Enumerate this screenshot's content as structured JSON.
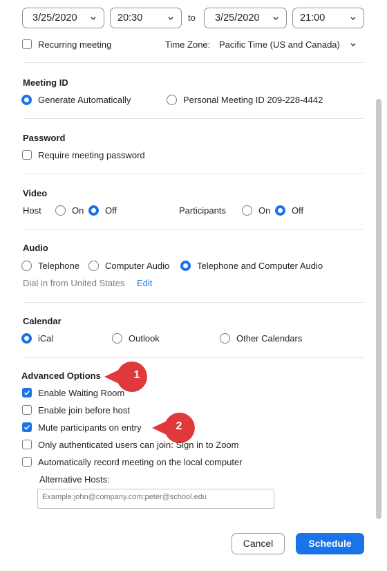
{
  "datetime": {
    "start_date": "3/25/2020",
    "start_time": "20:30",
    "to_label": "to",
    "end_date": "3/25/2020",
    "end_time": "21:00"
  },
  "recurring": {
    "label": "Recurring meeting",
    "checked": false
  },
  "timezone": {
    "label": "Time Zone:",
    "value": "Pacific Time (US and Canada)"
  },
  "meeting_id": {
    "heading": "Meeting ID",
    "options": [
      "Generate Automatically",
      "Personal Meeting ID 209-228-4442"
    ],
    "selected": "Generate Automatically"
  },
  "password": {
    "heading": "Password",
    "label": "Require meeting password",
    "checked": false
  },
  "video": {
    "heading": "Video",
    "host_label": "Host",
    "participants_label": "Participants",
    "on_label": "On",
    "off_label": "Off",
    "host_value": "Off",
    "participants_value": "Off"
  },
  "audio": {
    "heading": "Audio",
    "options": [
      "Telephone",
      "Computer Audio",
      "Telephone and Computer Audio"
    ],
    "selected": "Telephone and Computer Audio",
    "dial_in": "Dial in from United States",
    "edit_label": "Edit"
  },
  "calendar": {
    "heading": "Calendar",
    "options": [
      "iCal",
      "Outlook",
      "Other Calendars"
    ],
    "selected": "iCal"
  },
  "advanced": {
    "heading": "Advanced Options",
    "options": [
      {
        "label": "Enable Waiting Room",
        "checked": true
      },
      {
        "label": "Enable join before host",
        "checked": false
      },
      {
        "label": "Mute participants on entry",
        "checked": true
      },
      {
        "label": "Only authenticated users can join: Sign in to Zoom",
        "checked": false
      },
      {
        "label": "Automatically record meeting on the local computer",
        "checked": false
      }
    ],
    "alt_hosts_label": "Alternative Hosts:",
    "alt_hosts_placeholder": "Example:john@company.com;peter@school.edu"
  },
  "annotations": {
    "badge1": "1",
    "badge2": "2",
    "badge_color": "#e0393b"
  },
  "buttons": {
    "cancel": "Cancel",
    "schedule": "Schedule"
  },
  "colors": {
    "accent": "#1a73e8"
  }
}
